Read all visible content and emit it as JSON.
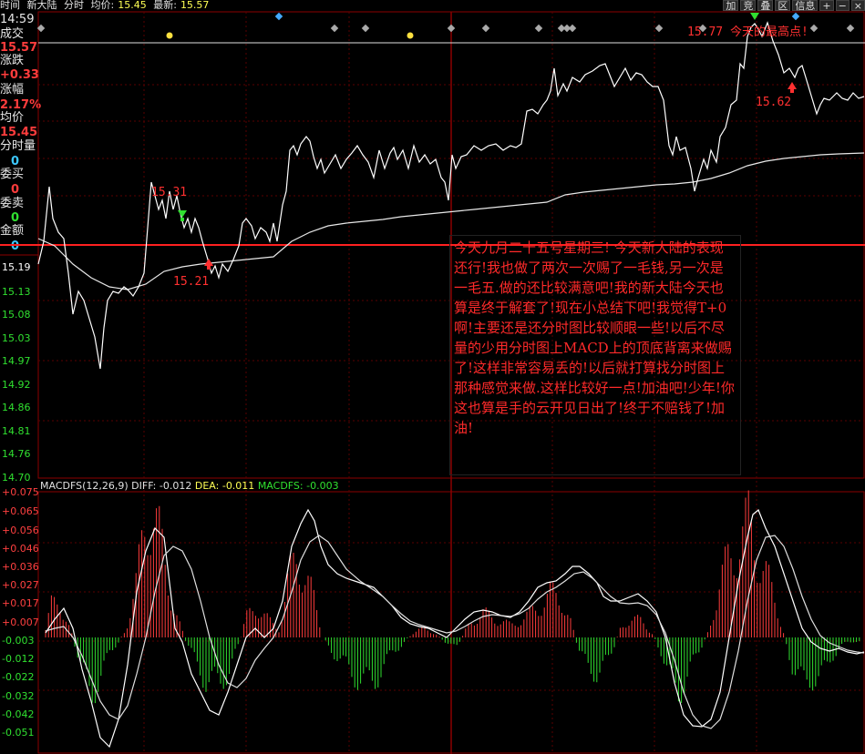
{
  "header": {
    "time_label": "时间",
    "time_value": "14:59",
    "stock_name": "新大陆",
    "chart_mode": "分时",
    "avg_label": "均价:",
    "avg_value": "15.45",
    "latest_label": "最新:",
    "latest_value": "15.57",
    "buttons": [
      "加",
      "竞",
      "叠",
      "区",
      "信息",
      "+",
      "−",
      "×"
    ]
  },
  "stats_panel": [
    {
      "label": "成交",
      "value": "15.57"
    },
    {
      "label": "涨跌",
      "value": "+0.33"
    },
    {
      "label": "涨幅",
      "value": "2.17%"
    },
    {
      "label": "均价",
      "value": "15.45"
    },
    {
      "label": "分时量",
      "value": "0"
    },
    {
      "label": "委买",
      "value": "0"
    },
    {
      "label": "委卖",
      "value": "0"
    },
    {
      "label": "金额",
      "value": "0"
    }
  ],
  "price_axis": [
    "15.19",
    "15.13",
    "15.08",
    "15.03",
    "14.97",
    "14.92",
    "14.86",
    "14.81",
    "14.76",
    "14.70"
  ],
  "annotations": {
    "high_note": "15.77 今天的最高点!",
    "mark_1531": "15.31",
    "mark_1521": "15.21",
    "mark_1562": "15.62"
  },
  "comment_text": "今天九月二十五号星期三! 今天新大陆的表现还行!我也做了两次一次赐了一毛钱,另一次是一毛五.做的还比较满意吧!我的新大陆今天也算是终于解套了!现在小总结下吧!我觉得T+0啊!主要还是还分时图比较顺眼一些!以后不尽量的少用分时图上MACD上的顶底背离来做赐了!这样非常容易丢的!以后就打算找分时图上那种感觉来做.这样比较好一点!加油吧!少年!你这也算是手的云开见日出了!终于不赔钱了!加油!",
  "macd": {
    "title": "MACDFS(12,26,9)",
    "diff_label": "DIFF:",
    "diff_value": "-0.012",
    "dea_label": "DEA:",
    "dea_value": "-0.011",
    "macdfs_label": "MACDFS:",
    "macdfs_value": "-0.003",
    "axis": [
      "+0.075",
      "+0.065",
      "+0.056",
      "+0.046",
      "+0.036",
      "+0.027",
      "+0.017",
      "+0.007",
      "-0.003",
      "-0.012",
      "-0.022",
      "-0.032",
      "-0.042",
      "-0.051"
    ]
  },
  "colors": {
    "up": "#ff3c3c",
    "down": "#30e030",
    "price_line": "#ffffff",
    "background": "#000000"
  }
}
